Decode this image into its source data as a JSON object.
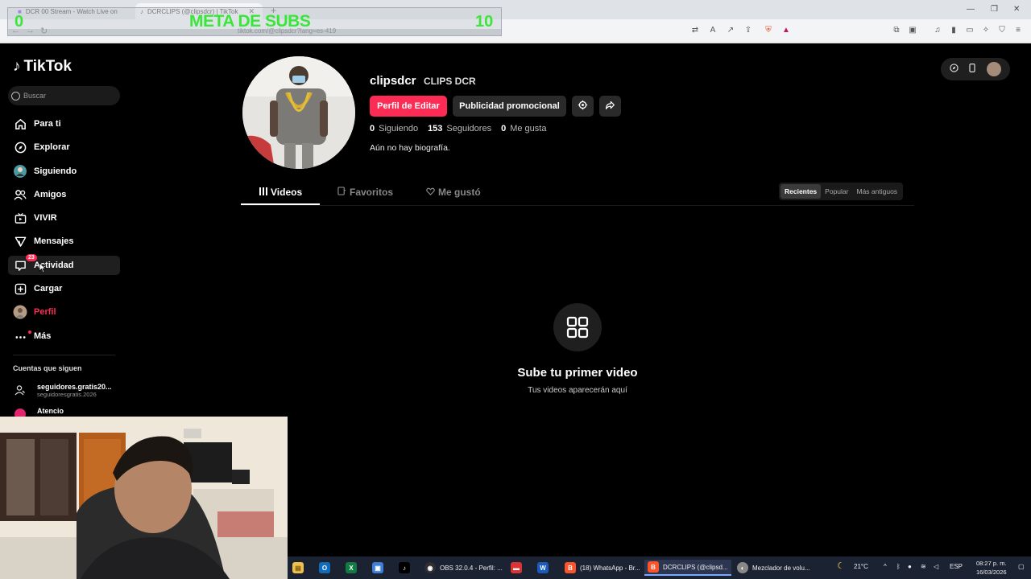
{
  "browser": {
    "tabs": [
      {
        "title": "DCR 00 Stream - Watch Live on"
      },
      {
        "title": "DCRCLIPS (@clipsdcr) | TikTok"
      }
    ],
    "new_tab": "+",
    "url": "tiktok.com/@clipsdcr?lang=es-419"
  },
  "overlay": {
    "title": "META DE SUBS",
    "start": "0",
    "goal": "10"
  },
  "sidebar": {
    "brand": "TikTok",
    "search_placeholder": "Buscar",
    "items": [
      {
        "label": "Para ti",
        "icon": "home-icon"
      },
      {
        "label": "Explorar",
        "icon": "compass-icon"
      },
      {
        "label": "Siguiendo",
        "icon": "following-avatar-icon"
      },
      {
        "label": "Amigos",
        "icon": "friends-icon"
      },
      {
        "label": "VIVIR",
        "icon": "live-icon"
      },
      {
        "label": "Mensajes",
        "icon": "messages-icon"
      },
      {
        "label": "Actividad",
        "icon": "activity-icon",
        "badge": "23"
      },
      {
        "label": "Cargar",
        "icon": "upload-icon"
      },
      {
        "label": "Perfil",
        "icon": "profile-avatar-icon"
      },
      {
        "label": "Más",
        "icon": "more-icon"
      }
    ],
    "following_title": "Cuentas que siguen",
    "suggested": [
      {
        "name": "seguidores.gratis20...",
        "handle": "seguidoresgratis.2026"
      },
      {
        "name": "Atencio",
        "handle": ""
      }
    ]
  },
  "profile": {
    "username": "clipsdcr",
    "nickname": "CLIPS DCR",
    "edit_button": "Perfil de Editar",
    "promo_button": "Publicidad promocional",
    "following_count": "0",
    "following_label": "Siguiendo",
    "followers_count": "153",
    "followers_label": "Seguidores",
    "likes_count": "0",
    "likes_label": "Me gusta",
    "bio": "Aún no hay biografía.",
    "tabs": [
      "Videos",
      "Favoritos",
      "Me gustó"
    ],
    "sort_options": [
      "Recientes",
      "Popular",
      "Más antiguos"
    ],
    "empty_title": "Sube tu primer video",
    "empty_subtitle": "Tus videos aparecerán aquí"
  },
  "taskbar": {
    "apps": [
      {
        "label": "OBS 32.0.4 - Perfil: ..."
      },
      {
        "label": "(18) WhatsApp - Br..."
      },
      {
        "label": "DCRCLIPS (@clipsd..."
      },
      {
        "label": "Mezclador de volu..."
      }
    ],
    "weather": "21°C",
    "language": "ESP",
    "time": "08:27 p. m.",
    "date": "16/03/2026"
  },
  "colors": {
    "accent": "#fe2c55",
    "background": "#000000",
    "overlay_text": "#39e639"
  }
}
